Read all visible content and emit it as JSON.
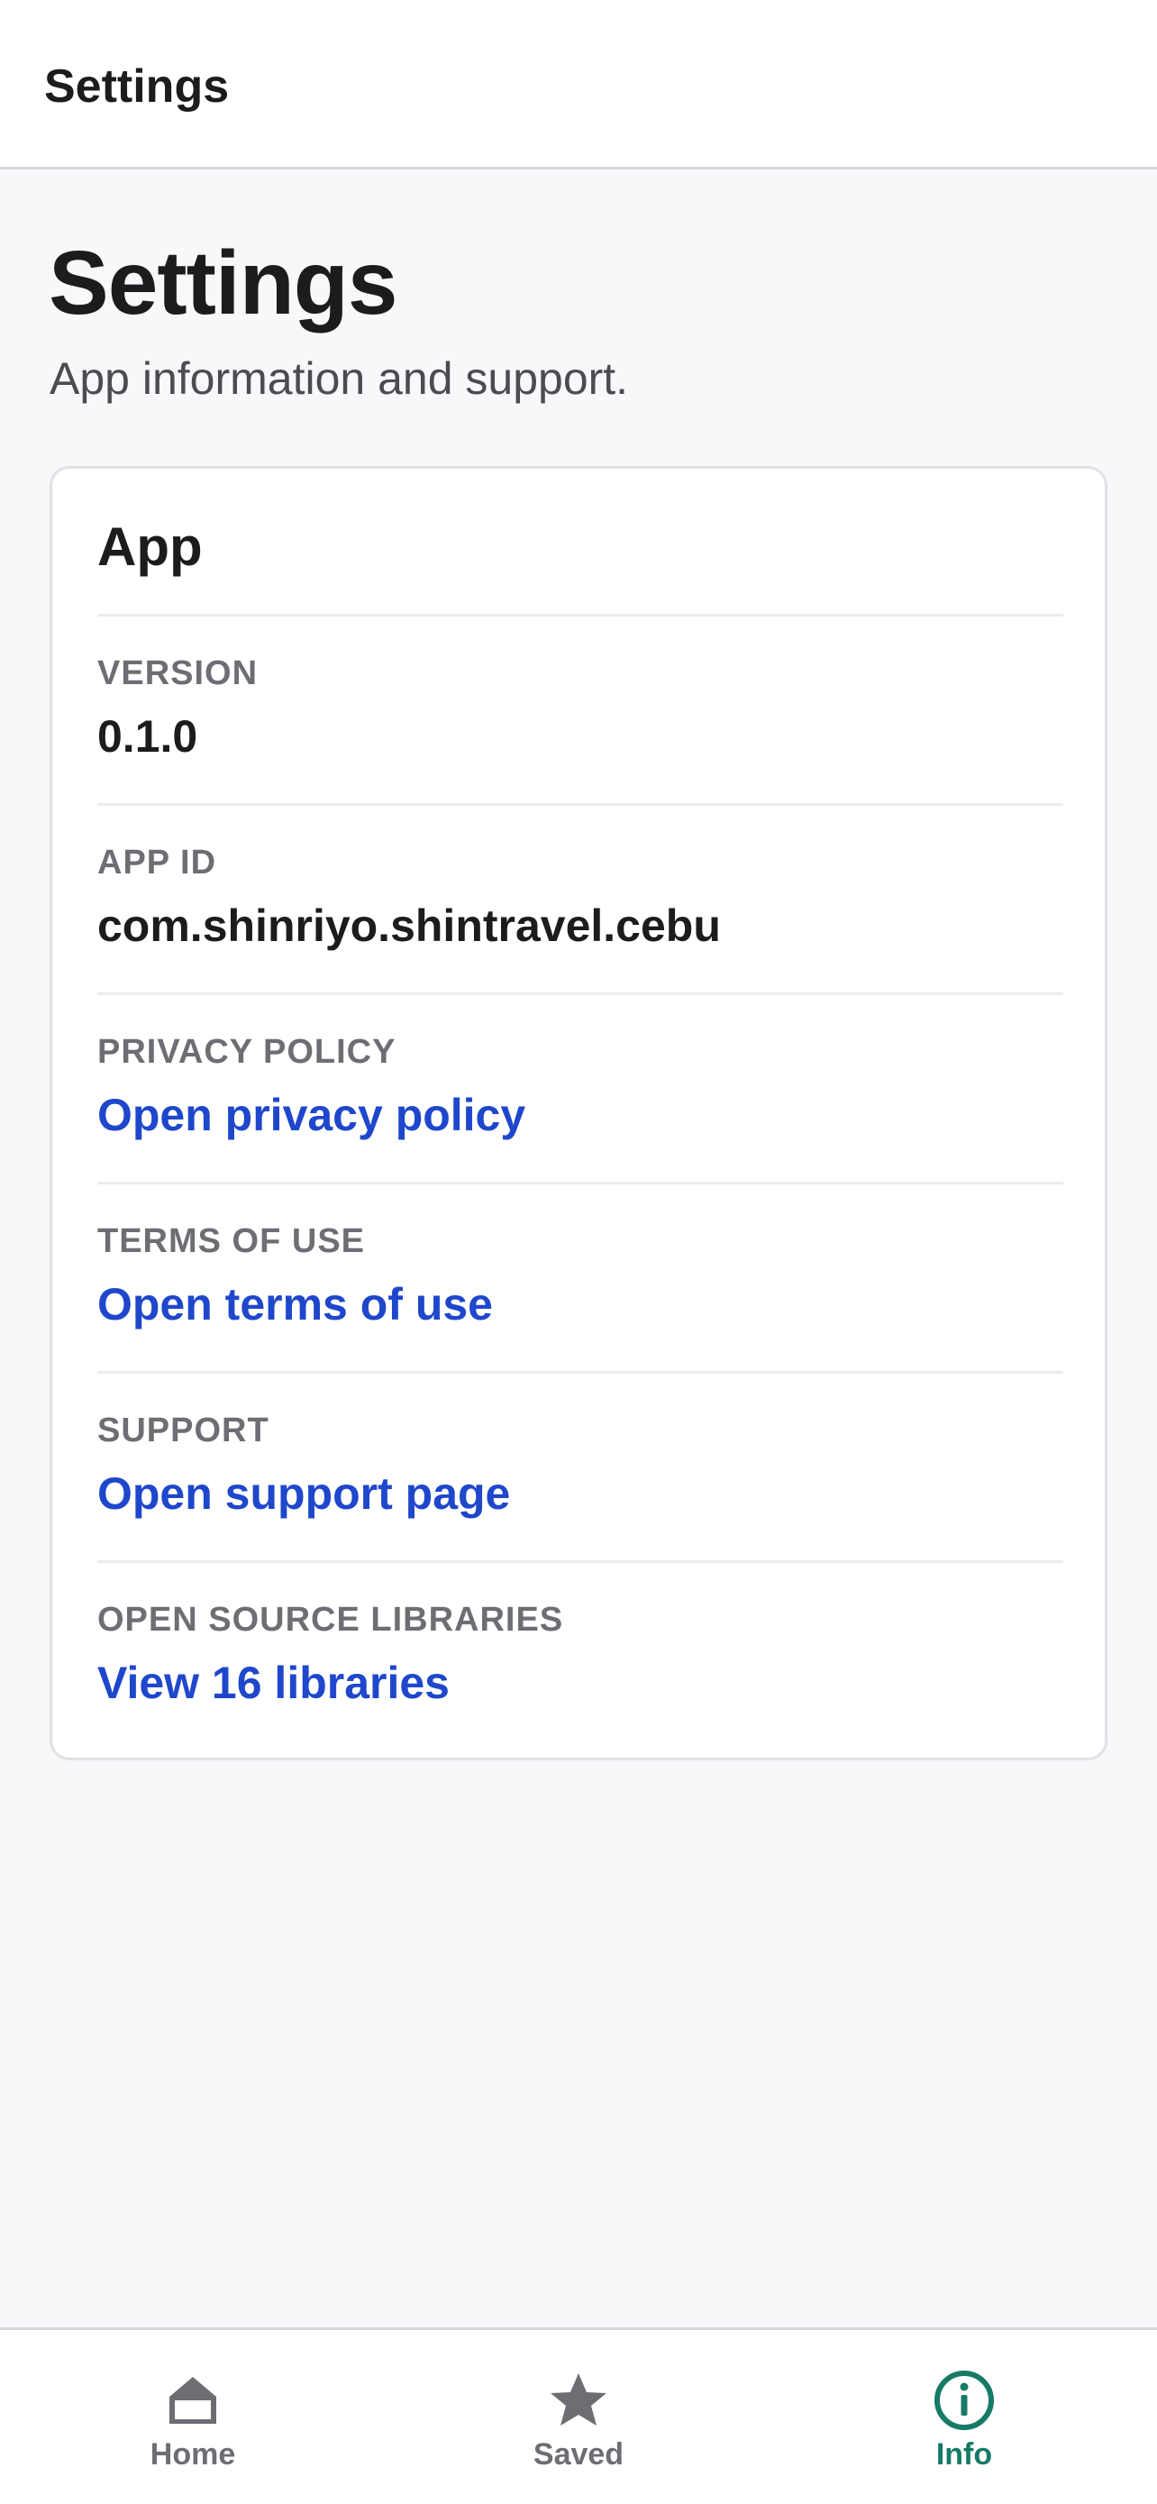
{
  "nav": {
    "title": "Settings"
  },
  "header": {
    "title": "Settings",
    "subtitle": "App information and support."
  },
  "card": {
    "title": "App",
    "rows": [
      {
        "label": "VERSION",
        "value": "0.1.0",
        "type": "text"
      },
      {
        "label": "APP ID",
        "value": "com.shinriyo.shintravel.cebu",
        "type": "text"
      },
      {
        "label": "PRIVACY POLICY",
        "value": "Open privacy policy",
        "type": "link"
      },
      {
        "label": "TERMS OF USE",
        "value": "Open terms of use",
        "type": "link"
      },
      {
        "label": "SUPPORT",
        "value": "Open support page",
        "type": "link"
      },
      {
        "label": "OPEN SOURCE LIBRARIES",
        "value": "View 16 libraries",
        "type": "link"
      }
    ]
  },
  "tabbar": {
    "items": [
      {
        "label": "Home",
        "icon": "home-icon",
        "active": false
      },
      {
        "label": "Saved",
        "icon": "star-icon",
        "active": false
      },
      {
        "label": "Info",
        "icon": "info-icon",
        "active": true
      }
    ]
  },
  "colors": {
    "link": "#1f47cc",
    "active_tab": "#167a66",
    "inactive_tab": "#6d6e74",
    "background": "#f7f8fa"
  }
}
